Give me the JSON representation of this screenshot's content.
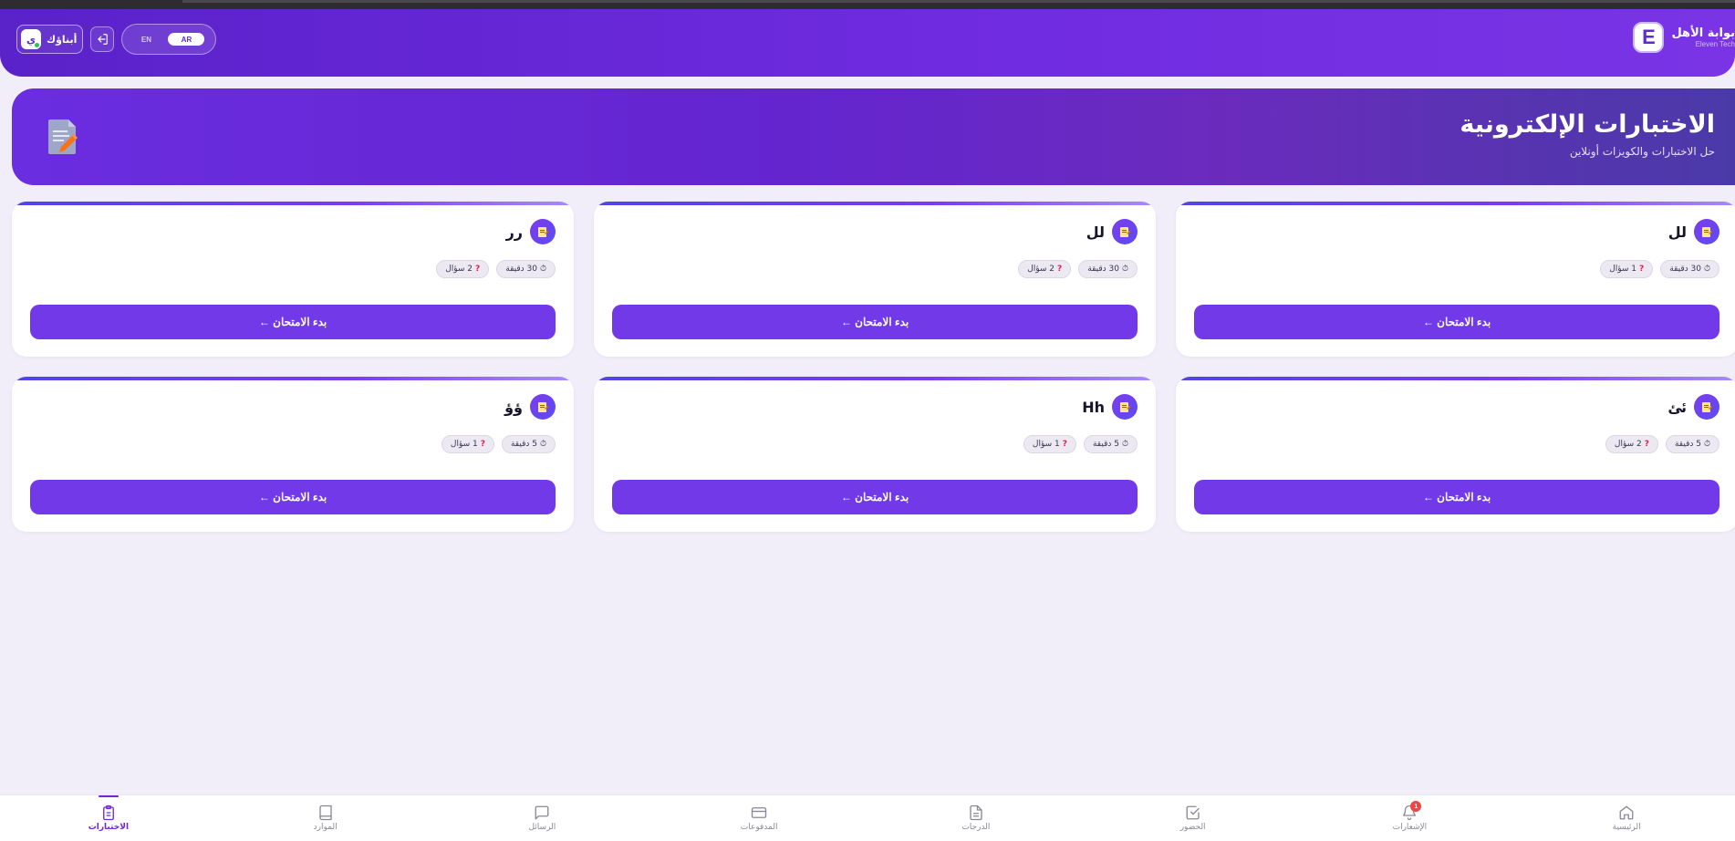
{
  "header": {
    "brand_title": "بوابة الأهل",
    "brand_subtitle": "Eleven Tech",
    "brand_logo_letter": "E",
    "user_name": "أبناؤك",
    "user_avatar_letter": "ي",
    "lang_en": "EN",
    "lang_ar": "AR",
    "active_lang": "AR"
  },
  "banner": {
    "title": "الاختبارات الإلكترونية",
    "subtitle": "حل الاختبارات والكويزات أونلاين"
  },
  "exams": [
    {
      "title": "لل",
      "duration": "30 دقيقة",
      "questions": "1 سؤال",
      "button": "بدء الامتحان ←"
    },
    {
      "title": "لل",
      "duration": "30 دقيقة",
      "questions": "2 سؤال",
      "button": "بدء الامتحان ←"
    },
    {
      "title": "رر",
      "duration": "30 دقيقة",
      "questions": "2 سؤال",
      "button": "بدء الامتحان ←"
    },
    {
      "title": "ئئ",
      "duration": "5 دقيقة",
      "questions": "2 سؤال",
      "button": "بدء الامتحان ←"
    },
    {
      "title": "Hh",
      "duration": "5 دقيقة",
      "questions": "1 سؤال",
      "button": "بدء الامتحان ←"
    },
    {
      "title": "ؤؤ",
      "duration": "5 دقيقة",
      "questions": "1 سؤال",
      "button": "بدء الامتحان ←"
    }
  ],
  "bottom_nav": {
    "items": [
      {
        "label": "الرئيسية",
        "icon": "home-icon"
      },
      {
        "label": "الإشعارات",
        "icon": "bell-icon",
        "badge": "1"
      },
      {
        "label": "الحضور",
        "icon": "check-square-icon"
      },
      {
        "label": "الدرجات",
        "icon": "document-icon"
      },
      {
        "label": "المدفوعات",
        "icon": "credit-card-icon"
      },
      {
        "label": "الرسائل",
        "icon": "message-icon"
      },
      {
        "label": "الموارد",
        "icon": "book-icon"
      },
      {
        "label": "الاختبارات",
        "icon": "clipboard-icon",
        "active": true
      }
    ]
  },
  "colors": {
    "primary": "#7139e8",
    "header_gradient_start": "#5a22c9",
    "header_gradient_end": "#7a34e6",
    "background": "#f1eef9",
    "badge": "#ef4444",
    "online": "#22c55e"
  }
}
